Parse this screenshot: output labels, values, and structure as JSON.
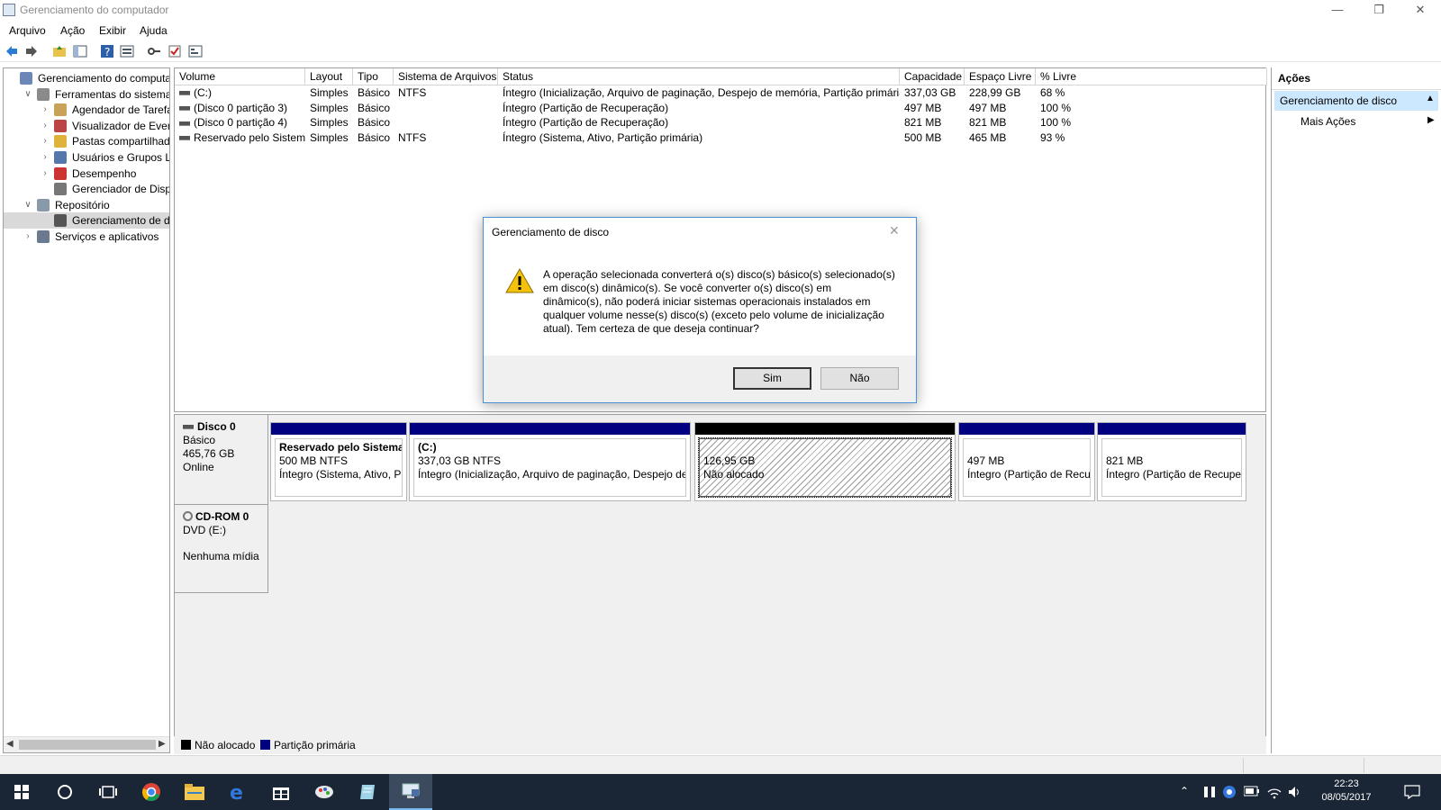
{
  "window": {
    "title": "Gerenciamento do computador"
  },
  "menu": [
    "Arquivo",
    "Ação",
    "Exibir",
    "Ajuda"
  ],
  "toolbar_icons": [
    "back-icon",
    "forward-icon",
    "up-folder-icon",
    "show-hide-tree-icon",
    "help-icon",
    "properties-icon",
    "key-icon",
    "check-icon",
    "console-icon"
  ],
  "tree": [
    {
      "label": "Gerenciamento do computado",
      "indent": 0,
      "arrow": "",
      "icon": "computer"
    },
    {
      "label": "Ferramentas do sistema",
      "indent": 1,
      "arrow": "v",
      "icon": "tools"
    },
    {
      "label": "Agendador de Tarefas",
      "indent": 2,
      "arrow": ">",
      "icon": "clock"
    },
    {
      "label": "Visualizador de Eventos",
      "indent": 2,
      "arrow": ">",
      "icon": "event"
    },
    {
      "label": "Pastas compartilhadas",
      "indent": 2,
      "arrow": ">",
      "icon": "folder"
    },
    {
      "label": "Usuários e Grupos Loca",
      "indent": 2,
      "arrow": ">",
      "icon": "users"
    },
    {
      "label": "Desempenho",
      "indent": 2,
      "arrow": ">",
      "icon": "perf"
    },
    {
      "label": "Gerenciador de Disposit",
      "indent": 2,
      "arrow": "",
      "icon": "device"
    },
    {
      "label": "Repositório",
      "indent": 1,
      "arrow": "v",
      "icon": "storage"
    },
    {
      "label": "Gerenciamento de disco",
      "indent": 2,
      "arrow": "",
      "icon": "disk",
      "selected": true
    },
    {
      "label": "Serviços e aplicativos",
      "indent": 1,
      "arrow": ">",
      "icon": "services"
    }
  ],
  "volumes": {
    "headers": [
      "Volume",
      "Layout",
      "Tipo",
      "Sistema de Arquivos",
      "Status",
      "Capacidade",
      "Espaço Livre",
      "% Livre"
    ],
    "rows": [
      [
        "(C:)",
        "Simples",
        "Básico",
        "NTFS",
        "Íntegro (Inicialização, Arquivo de paginação, Despejo de memória, Partição primária)",
        "337,03 GB",
        "228,99 GB",
        "68 %"
      ],
      [
        "(Disco 0 partição 3)",
        "Simples",
        "Básico",
        "",
        "Íntegro (Partição de Recuperação)",
        "497 MB",
        "497 MB",
        "100 %"
      ],
      [
        "(Disco 0 partição 4)",
        "Simples",
        "Básico",
        "",
        "Íntegro (Partição de Recuperação)",
        "821 MB",
        "821 MB",
        "100 %"
      ],
      [
        "Reservado pelo Sistema",
        "Simples",
        "Básico",
        "NTFS",
        "Íntegro (Sistema, Ativo, Partição primária)",
        "500 MB",
        "465 MB",
        "93 %"
      ]
    ]
  },
  "disk0": {
    "name": "Disco 0",
    "type": "Básico",
    "size": "465,76 GB",
    "state": "Online",
    "partitions": [
      {
        "title": "Reservado pelo Sistema",
        "line1": "500 MB NTFS",
        "line2": "Íntegro (Sistema, Ativo, Pai",
        "kind": "primary"
      },
      {
        "title": "(C:)",
        "line1": "337,03 GB NTFS",
        "line2": "Íntegro (Inicialização, Arquivo de paginação, Despejo de m",
        "kind": "primary"
      },
      {
        "title": "",
        "line1": "126,95 GB",
        "line2": "Não alocado",
        "kind": "unallocated"
      },
      {
        "title": "",
        "line1": "497 MB",
        "line2": "Íntegro (Partição de Recup",
        "kind": "primary"
      },
      {
        "title": "",
        "line1": "821 MB",
        "line2": "Íntegro (Partição de Recupera",
        "kind": "primary"
      }
    ]
  },
  "cdrom0": {
    "name": "CD-ROM 0",
    "type": "DVD (E:)",
    "media": "Nenhuma mídia"
  },
  "legend": [
    {
      "label": "Não alocado",
      "color": "#000000"
    },
    {
      "label": "Partição primária",
      "color": "#000080"
    }
  ],
  "actions": {
    "title": "Ações",
    "section": "Gerenciamento de disco",
    "more": "Mais Ações"
  },
  "dialog": {
    "title": "Gerenciamento de disco",
    "message_lines": [
      "A operação selecionada converterá o(s) disco(s) básico(s) selecionado(s)",
      "em disco(s) dinâmico(s). Se você converter o(s) disco(s) em",
      "dinâmico(s), não poderá iniciar sistemas operacionais instalados em",
      "qualquer volume nesse(s) disco(s) (exceto pelo volume de inicialização",
      "atual). Tem certeza de que deseja continuar?"
    ],
    "yes": "Sim",
    "no": "Não"
  },
  "taskbar": {
    "time": "22:23",
    "date": "08/05/2017"
  },
  "colors": {
    "primary_partition": "#000080",
    "unallocated": "#000000",
    "taskbar": "#1a2536",
    "selection": "#cce8ff"
  }
}
